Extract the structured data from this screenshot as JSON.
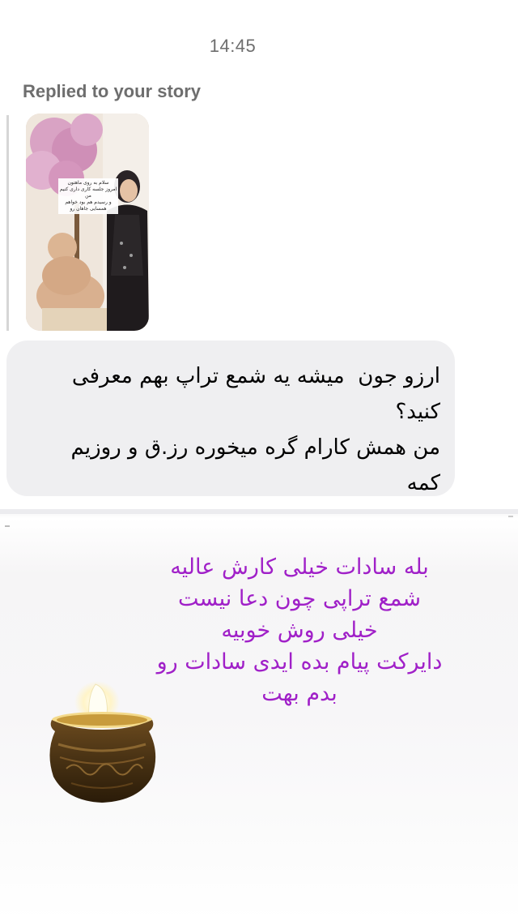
{
  "thread": {
    "timestamp": "14:45",
    "replied_label": "Replied to your story"
  },
  "story": {
    "caption_lines": [
      "سلام به روی ماهتون",
      "امروز جلسه کاری داری کنیم من",
      "و رسیدم هم بود خواهم همسایی جاهان رو"
    ]
  },
  "incoming_message": {
    "text": "ارزو جون  میشه یه شمع تراپ بهم معرفی کنید؟\nمن همش کارام گره میخوره رز.ق و روزیم کمه"
  },
  "reply_overlay": {
    "lines": [
      "بله سادات خیلی کارش عالیه",
      "شمع تراپی چون دعا نیست",
      "خیلی روش خوبیه",
      "دایرکت پیام بده ایدی سادات رو",
      "بدم بهت"
    ],
    "text_color": "#a020c8"
  },
  "icons": {
    "candle": "candle-pot-icon"
  }
}
